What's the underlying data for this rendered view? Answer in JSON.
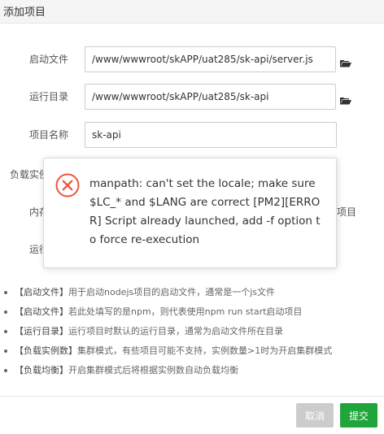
{
  "dialog": {
    "title": "添加项目"
  },
  "form": {
    "start_file": {
      "label": "启动文件",
      "value": "/www/wwwroot/skAPP/uat285/sk-api/server.js",
      "browse_icon": "folder-open-icon"
    },
    "run_dir": {
      "label": "运行目录",
      "value": "/www/wwwroot/skAPP/uat285/sk-api",
      "browse_icon": "folder-open-icon"
    },
    "project_name": {
      "label": "项目名称",
      "value": "sk-api"
    },
    "partial_labels": {
      "load_instances": "负载实例",
      "memory": "内存",
      "run": "运行",
      "project_suffix": "项目"
    }
  },
  "error_popup": {
    "icon": "error-circle-x-icon",
    "message": "manpath: can't set the locale; make sure $LC_* and $LANG are correct [PM2][ERROR] Script already launched, add -f option to force re-execution",
    "icon_color": "#f0553c"
  },
  "tips": [
    {
      "tag": "【启动文件】",
      "text": "用于启动nodejs项目的启动文件，通常是一个js文件"
    },
    {
      "tag": "【启动文件】",
      "text": "若此处填写的是npm，则代表使用npm run start启动项目"
    },
    {
      "tag": "【运行目录】",
      "text": "运行项目时默认的运行目录，通常为启动文件所在目录"
    },
    {
      "tag": "【负载实例数】",
      "text": "集群模式，有些项目可能不支持，实例数量>1时为开启集群模式"
    },
    {
      "tag": "【负载均衡】",
      "text": "开启集群模式后将根据实例数自动负载均衡"
    }
  ],
  "footer": {
    "cancel_label": "取消",
    "submit_label": "提交",
    "submit_color": "#20a53a",
    "cancel_color": "#cccccc"
  }
}
